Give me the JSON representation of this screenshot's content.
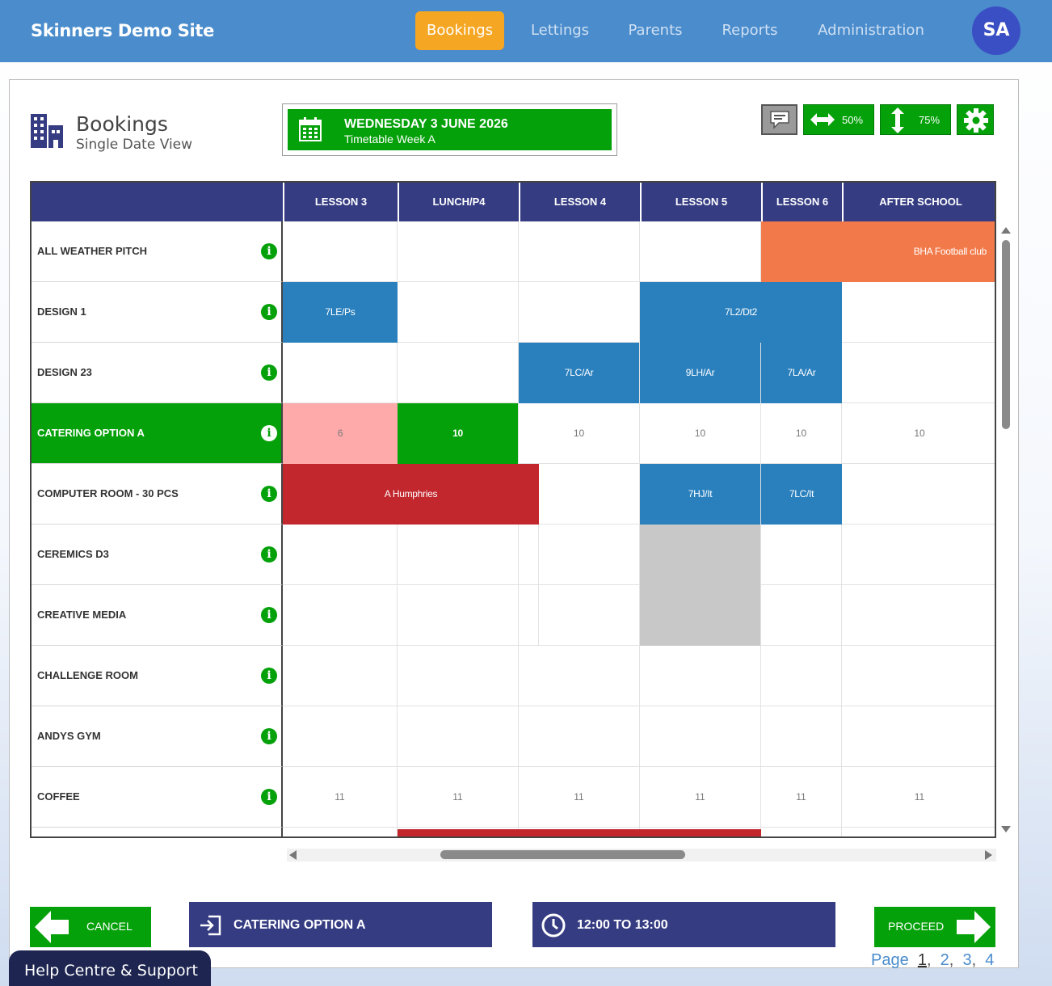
{
  "site": {
    "title": "Skinners Demo Site"
  },
  "nav": {
    "items": [
      "Bookings",
      "Lettings",
      "Parents",
      "Reports",
      "Administration"
    ],
    "active": "Bookings",
    "user_initials": "SA"
  },
  "page": {
    "title": "Bookings",
    "subtitle": "Single Date View"
  },
  "date_selector": {
    "date": "WEDNESDAY 3 JUNE 2026",
    "week": "Timetable Week A"
  },
  "toolbar": {
    "width_zoom": "50%",
    "height_zoom": "75%"
  },
  "grid": {
    "columns": [
      "LESSON 3",
      "LUNCH/P4",
      "LESSON 4",
      "LESSON 5",
      "LESSON 6",
      "AFTER SCHOOL"
    ],
    "rows": [
      "ALL WEATHER PITCH",
      "DESIGN 1",
      "DESIGN 23",
      "CATERING OPTION A",
      "COMPUTER ROOM - 30 PCS",
      "CEREMICS D3",
      "CREATIVE MEDIA",
      "CHALLENGE ROOM",
      "ANDYS GYM",
      "COFFEE"
    ],
    "selected_row": "CATERING OPTION A",
    "bookings": {
      "all_weather_pitch_after": "BHA Football club",
      "design1_l3": "7LE/Ps",
      "design1_l5": "7L2/Dt2",
      "design23_l4": "7LC/Ar",
      "design23_l5": "9LH/Ar",
      "design23_l6": "7LA/Ar",
      "computer_room_span": "A Humphries",
      "computer_room_l5": "7HJ/It",
      "computer_room_l6": "7LC/It"
    },
    "catering_counts": [
      "6",
      "10",
      "10",
      "10",
      "10",
      "10"
    ],
    "coffee_counts": [
      "11",
      "11",
      "11",
      "11",
      "11",
      "11"
    ]
  },
  "colors": {
    "nav_bg": "#4a8ccc",
    "nav_active": "#f5a623",
    "header_bg": "#353c82",
    "green": "#05a10a",
    "booking_blue": "#2a80bd",
    "booking_orange": "#f27a4a",
    "booking_red": "#c1272d",
    "pink": "#ffaaaa",
    "blocked_grey": "#c8c8c8"
  },
  "pagination": {
    "label": "Page",
    "pages": [
      "1",
      "2",
      "3",
      "4"
    ],
    "current": "1"
  },
  "footer": {
    "cancel": "CANCEL",
    "resource": "CATERING OPTION A",
    "time": "12:00 TO 13:00",
    "proceed": "PROCEED"
  },
  "help": {
    "label": "Help Centre & Support"
  }
}
